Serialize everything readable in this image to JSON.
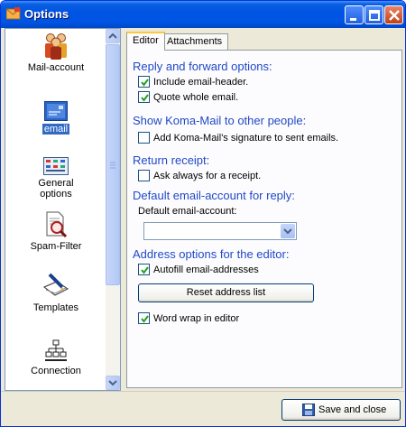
{
  "window": {
    "title": "Options"
  },
  "sidebar": {
    "items": [
      {
        "label": "Mail-account",
        "icon": "mail-account-icon"
      },
      {
        "label": "email",
        "icon": "email-icon",
        "selected": true
      },
      {
        "label": "General options",
        "icon": "general-options-icon"
      },
      {
        "label": "Spam-Filter",
        "icon": "spam-filter-icon"
      },
      {
        "label": "Templates",
        "icon": "templates-icon"
      },
      {
        "label": "Connection",
        "icon": "connection-icon"
      }
    ]
  },
  "tabs": [
    {
      "label": "Editor",
      "active": true
    },
    {
      "label": "Attachments",
      "active": false
    }
  ],
  "editor": {
    "reply_section": "Reply and forward options:",
    "include_header": {
      "label": "Include email-header.",
      "checked": true
    },
    "quote_whole": {
      "label": "Quote whole email.",
      "checked": true
    },
    "show_section": "Show Koma-Mail to other people:",
    "add_signature": {
      "label": "Add Koma-Mail's signature to sent emails.",
      "checked": false
    },
    "receipt_section": "Return receipt:",
    "ask_receipt": {
      "label": "Ask always for a receipt.",
      "checked": false
    },
    "default_account_section": "Default email-account for reply:",
    "default_account_label": "Default email-account:",
    "default_account_value": "",
    "address_section": "Address options for the editor:",
    "autofill": {
      "label": "Autofill email-addresses",
      "checked": true
    },
    "reset_button": "Reset address list",
    "word_wrap": {
      "label": "Word wrap in editor",
      "checked": true
    }
  },
  "footer": {
    "save_close": "Save and close"
  },
  "colors": {
    "titlebar": "#0054e3",
    "section_heading": "#2149c7",
    "selected": "#316ac5"
  }
}
